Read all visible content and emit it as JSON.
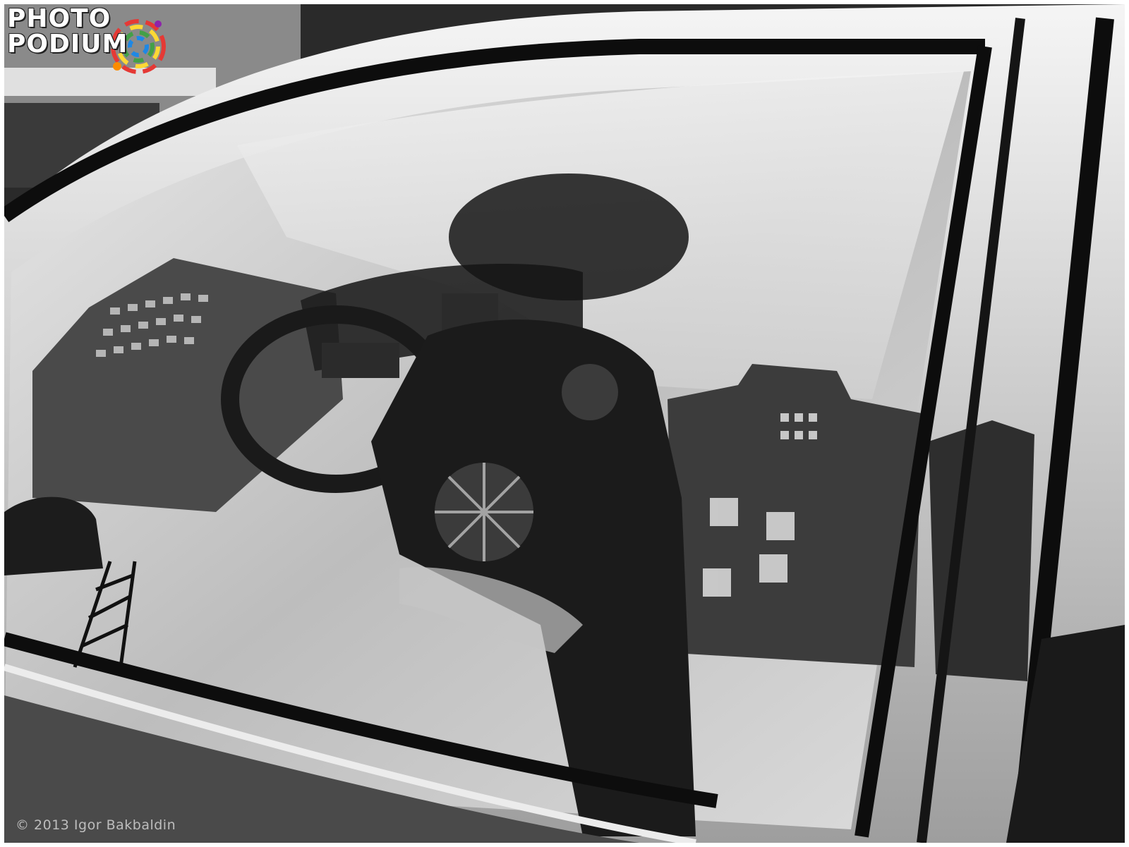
{
  "watermark": {
    "logo_line_1": "PHOTO",
    "logo_line_2": "PODIUM",
    "logo_colors": [
      "#e53935",
      "#fdd835",
      "#43a047",
      "#1e88e5",
      "#8e24aa",
      "#fb8c00"
    ]
  },
  "credit": {
    "copyright": "© 2013 Igor Bakbaldin"
  },
  "photo": {
    "style": "black-and-white high-contrast",
    "subject-icons": [
      "car-window",
      "steering-wheel",
      "reflected-buildings",
      "blurred-figure"
    ]
  }
}
